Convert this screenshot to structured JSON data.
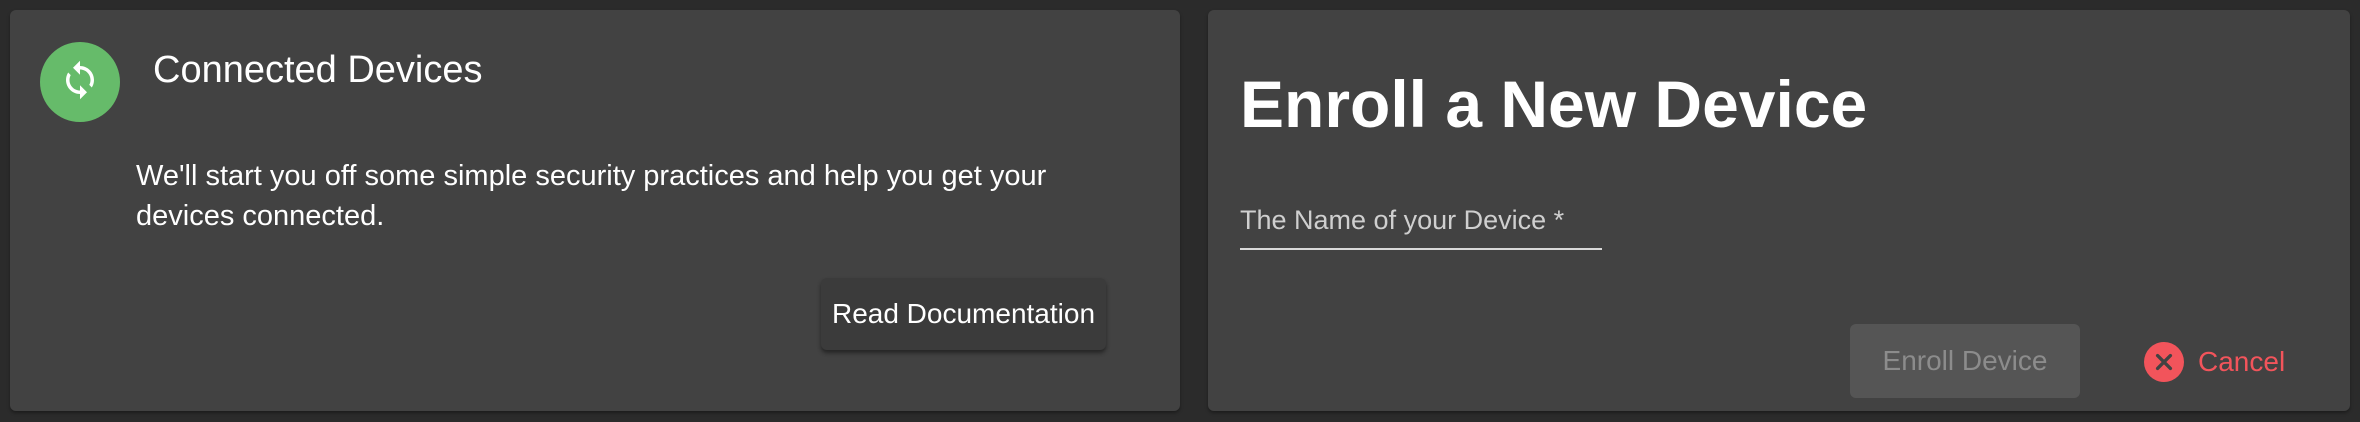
{
  "colors": {
    "page_background": "#2b2b2b",
    "card_background": "#424242",
    "avatar_green": "#66bb6a",
    "cancel_red": "#f2545b",
    "disabled_button": "#555555"
  },
  "connected_card": {
    "avatar_icon": "sync-icon",
    "title": "Connected Devices",
    "body": "We'll start you off some simple security practices and help you get your devices connected.",
    "read_docs_label": "Read Documentation"
  },
  "enroll_card": {
    "title": "Enroll a New Device",
    "device_name_placeholder": "The Name of your Device *",
    "device_name_value": "",
    "enroll_label": "Enroll Device",
    "enroll_disabled": true,
    "cancel_label": "Cancel",
    "cancel_icon": "close-circle-icon"
  }
}
